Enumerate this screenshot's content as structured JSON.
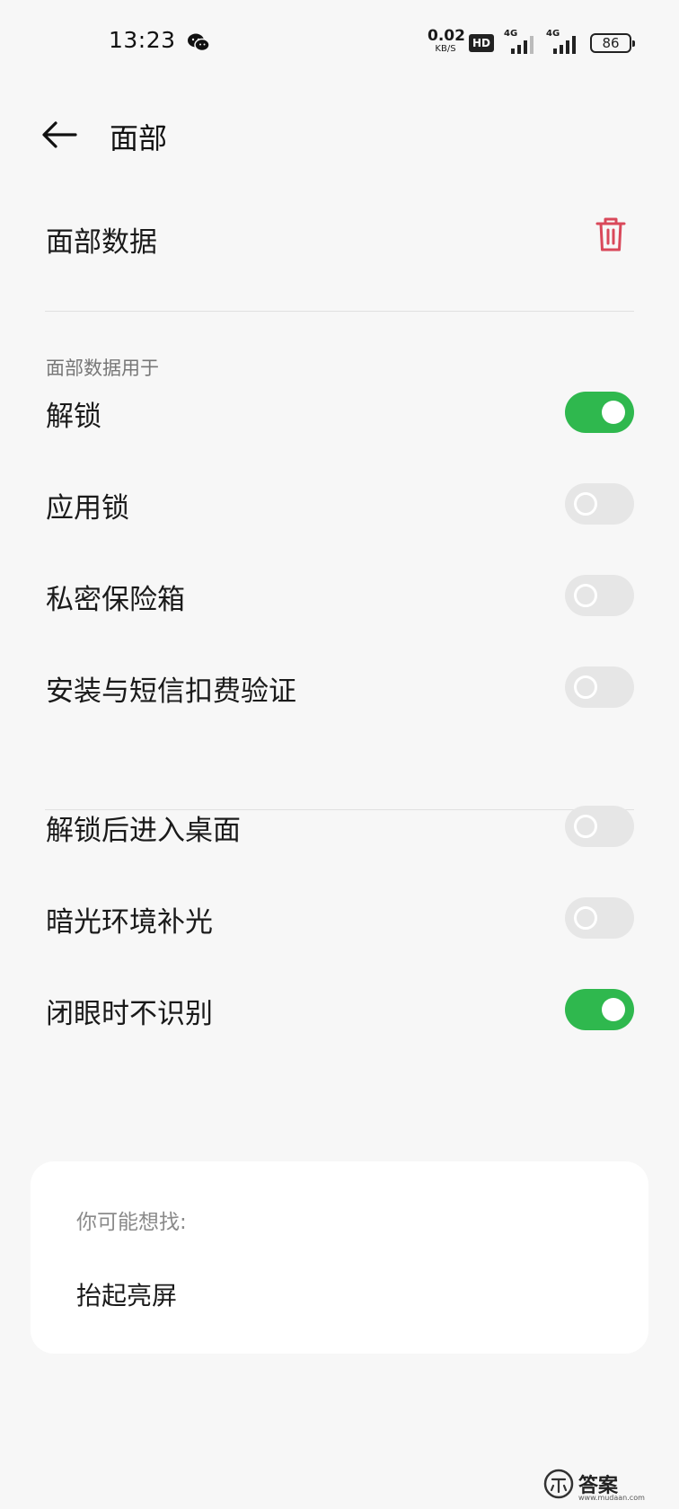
{
  "status_bar": {
    "time": "13:23",
    "net_speed_value": "0.02",
    "net_speed_unit": "KB/S",
    "hd_label": "HD",
    "signal_1_label": "4G",
    "signal_2_label": "4G",
    "battery": "86"
  },
  "header": {
    "title": "面部"
  },
  "face_data": {
    "label": "面部数据"
  },
  "section": {
    "title": "面部数据用于"
  },
  "toggles_group1": [
    {
      "label": "解锁",
      "on": true
    },
    {
      "label": "应用锁",
      "on": false
    },
    {
      "label": "私密保险箱",
      "on": false
    },
    {
      "label": "安装与短信扣费验证",
      "on": false
    }
  ],
  "toggles_group2": [
    {
      "label": "解锁后进入桌面",
      "on": false
    },
    {
      "label": "暗光环境补光",
      "on": false
    },
    {
      "label": "闭眼时不识别",
      "on": true
    }
  ],
  "suggest": {
    "title": "你可能想找:",
    "item": "抬起亮屏"
  },
  "watermark": {
    "text": "答案",
    "url": "www.mudaan.com"
  },
  "colors": {
    "toggle_on": "#2fb84e",
    "toggle_off": "#e6e6e6",
    "delete_icon": "#d9485a",
    "background": "#f7f7f7"
  }
}
